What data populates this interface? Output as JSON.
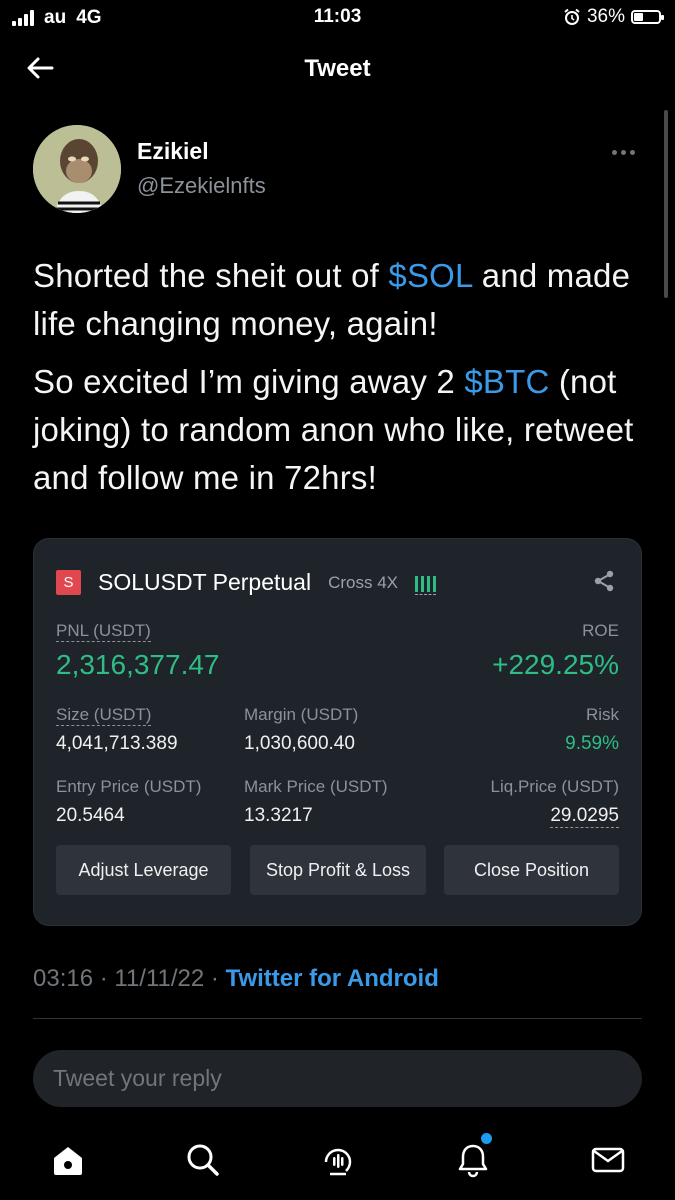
{
  "status_bar": {
    "carrier": "au",
    "network": "4G",
    "time": "11:03",
    "battery": "36%"
  },
  "header": {
    "title": "Tweet",
    "back_icon": "arrow-left-icon"
  },
  "author": {
    "name": "Ezikiel",
    "handle": "@Ezekielnfts",
    "more_icon": "more-horizontal-icon"
  },
  "tweet": {
    "p1_before": "Shorted the sheit out of ",
    "p1_tag": "$SOL",
    "p1_after": " and made life changing money, again!",
    "p2_before": "So excited I’m giving away 2 ",
    "p2_tag": "$BTC",
    "p2_after": " (not joking) to random anon who like, retweet and follow me in 72hrs!"
  },
  "card": {
    "badge": "S",
    "symbol": "SOLUSDT Perpetual",
    "mode": "Cross 4X",
    "pnl_label": "PNL (USDT)",
    "pnl_value": "2,316,377.47",
    "roe_label": "ROE",
    "roe_value": "+229.25%",
    "size_label": "Size (USDT)",
    "size_value": "4,041,713.389",
    "margin_label": "Margin (USDT)",
    "margin_value": "1,030,600.40",
    "risk_label": "Risk",
    "risk_value": "9.59%",
    "entry_label": "Entry Price (USDT)",
    "entry_value": "20.5464",
    "mark_label": "Mark Price (USDT)",
    "mark_value": "13.3217",
    "liq_label": "Liq.Price (USDT)",
    "liq_value": "29.0295",
    "buttons": {
      "adjust": "Adjust Leverage",
      "stop": "Stop Profit & Loss",
      "close": "Close Position"
    },
    "colors": {
      "green": "#2ebd85",
      "badge_red": "#e0474f",
      "card_bg": "#1f232a"
    }
  },
  "meta": {
    "time": "03:16",
    "sep1": " · ",
    "date": "11/11/22",
    "sep2": " · ",
    "source": "Twitter for Android"
  },
  "reply": {
    "placeholder": "Tweet your reply"
  },
  "nav": {
    "items": [
      "home-icon",
      "search-icon",
      "spaces-icon",
      "notifications-icon",
      "messages-icon"
    ]
  },
  "colors": {
    "accent": "#1d9bf0",
    "link": "#3b9ae8",
    "background": "#000000"
  }
}
